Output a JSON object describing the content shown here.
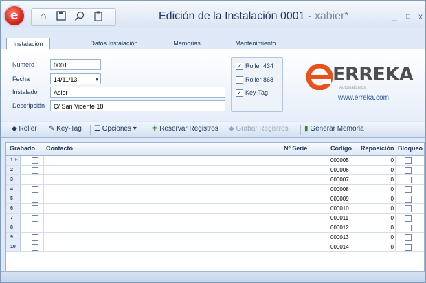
{
  "window": {
    "title": "Edición de la Instalación 0001 - ",
    "user": "xabier*",
    "minimize_glyph": "_",
    "restore_glyph": "□",
    "close_glyph": "x"
  },
  "quick_access": [
    "home-icon",
    "save-icon",
    "search-icon",
    "clipboard-icon"
  ],
  "tabs": [
    {
      "label": "Instalación"
    },
    {
      "label": "Datos Instalación"
    },
    {
      "label": "Memorias"
    },
    {
      "label": "Mantenimiento"
    }
  ],
  "form": {
    "numero": {
      "label": "Número",
      "value": "0001"
    },
    "fecha": {
      "label": "Fecha",
      "value": "14/11/13"
    },
    "instalador": {
      "label": "Instalador",
      "value": "Asier"
    },
    "descripcion": {
      "label": "Descripción",
      "value": "C/ San Vicente 18"
    }
  },
  "options": [
    {
      "label": "Roller 434",
      "checked": true
    },
    {
      "label": "Roller 868",
      "checked": false
    },
    {
      "label": "Key-Tag",
      "checked": true
    }
  ],
  "logo": {
    "wordmark": "ERREKA",
    "tagline": "Automatismos",
    "url": "www.erreka.com",
    "brand_color": "#e8501c"
  },
  "toolbar": {
    "roller": "Roller",
    "keytag": "Key-Tag",
    "opciones": "Opciones",
    "reservar": "Reservar Registros",
    "grabar": "Grabar Registros",
    "generar": "Generar Memoria"
  },
  "grid": {
    "headers": {
      "grabado": "Grabado",
      "contacto": "Contacto",
      "serie": "Nº Serie",
      "codigo": "Código",
      "reposicion": "Reposición",
      "bloqueo": "Bloqueo"
    },
    "rows": [
      {
        "n": "1",
        "codigo": "000005",
        "reposicion": "0"
      },
      {
        "n": "2",
        "codigo": "000006",
        "reposicion": "0"
      },
      {
        "n": "3",
        "codigo": "000007",
        "reposicion": "0"
      },
      {
        "n": "4",
        "codigo": "000008",
        "reposicion": "0"
      },
      {
        "n": "5",
        "codigo": "000009",
        "reposicion": "0"
      },
      {
        "n": "6",
        "codigo": "000010",
        "reposicion": "0"
      },
      {
        "n": "7",
        "codigo": "000011",
        "reposicion": "0"
      },
      {
        "n": "8",
        "codigo": "000012",
        "reposicion": "0"
      },
      {
        "n": "9",
        "codigo": "000013",
        "reposicion": "0"
      },
      {
        "n": "10",
        "codigo": "000014",
        "reposicion": "0"
      }
    ]
  }
}
